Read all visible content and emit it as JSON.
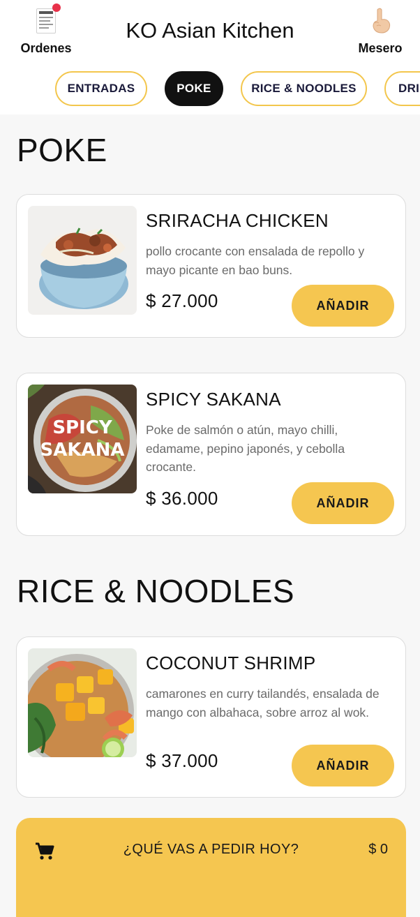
{
  "header": {
    "orders_label": "Ordenes",
    "title": "KO Asian Kitchen",
    "waiter_label": "Mesero",
    "receipt_icon_text": "RECEIPT",
    "notification_color": "#e8314a"
  },
  "tabs": [
    {
      "label": "ENTRADAS",
      "active": false
    },
    {
      "label": "POKE",
      "active": true
    },
    {
      "label": "RICE & NOODLES",
      "active": false
    },
    {
      "label": "DRI",
      "active": false
    }
  ],
  "sections": [
    {
      "title": "POKE",
      "items": [
        {
          "name": "SRIRACHA CHICKEN",
          "description": "pollo crocante con ensalada de repollo y mayo picante en bao buns.",
          "price": "$ 27.000",
          "button": "AÑADIR",
          "image": "bao-buns-bowl"
        },
        {
          "name": "SPICY SAKANA",
          "description": "Poke de salmón o atún, mayo chilli, edamame, pepino japonés, y cebolla crocante.",
          "price": "$ 36.000",
          "button": "AÑADIR",
          "image": "poke-bowl",
          "image_text_line1": "SPICY",
          "image_text_line2": "SAKANA"
        }
      ]
    },
    {
      "title": "RICE & NOODLES",
      "items": [
        {
          "name": "COCONUT SHRIMP",
          "description": "camarones en curry tailandés, ensalada de mango con albahaca, sobre arroz al wok.",
          "price": "$ 37.000",
          "button": "AÑADIR",
          "image": "shrimp-mango-bowl"
        }
      ]
    }
  ],
  "cart": {
    "prompt": "¿QUÉ VAS A PEDIR HOY?",
    "total": "$ 0",
    "icon": "cart-icon"
  },
  "colors": {
    "accent": "#f5c650",
    "tab_border": "#f3c64c",
    "active_tab": "#111111",
    "background": "#f7f7f7"
  }
}
